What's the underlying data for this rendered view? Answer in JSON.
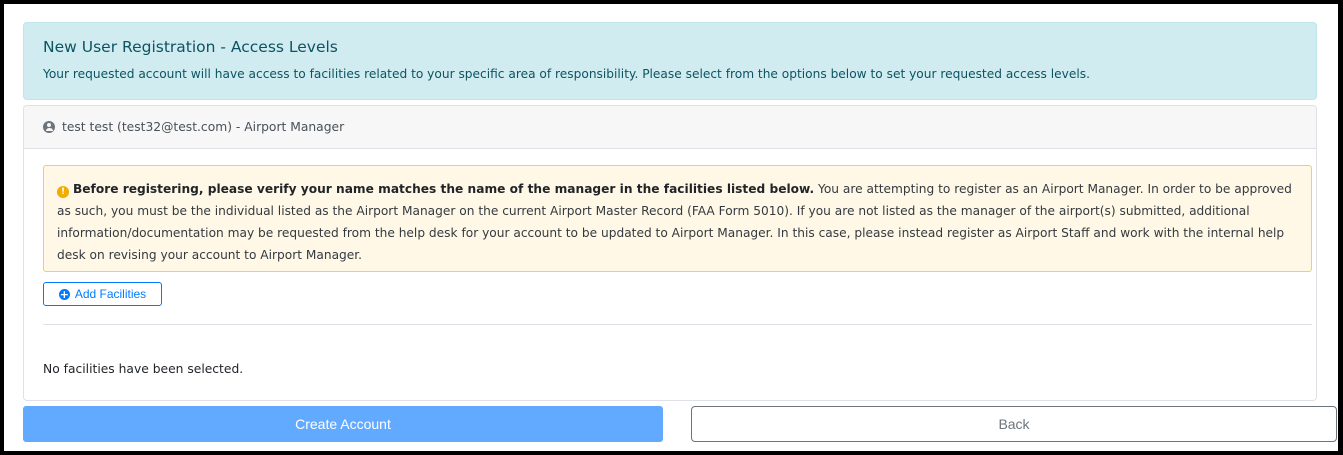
{
  "banner": {
    "title": "New User Registration - Access Levels",
    "text": "Your requested account will have access to facilities related to your specific area of responsibility. Please select from the options below to set your requested access levels."
  },
  "user_card": {
    "icon": "user-circle-icon",
    "header": "test test (test32@test.com) - Airport Manager"
  },
  "warning": {
    "icon": "exclamation-circle-icon",
    "bold": "Before registering, please verify your name matches the name of the manager in the facilities listed below.",
    "text": " You are attempting to register as an Airport Manager. In order to be approved as such, you must be the individual listed as the Airport Manager on the current Airport Master Record (FAA Form 5010). If you are not listed as the manager of the airport(s) submitted, additional information/documentation may be requested from the help desk for your account to be updated to Airport Manager. In this case, please instead register as Airport Staff and work with the internal help desk on revising your account to Airport Manager."
  },
  "facilities": {
    "add_label": "Add Facilities",
    "add_icon": "plus-circle-icon",
    "empty_message": "No facilities have been selected."
  },
  "actions": {
    "create_label": "Create Account",
    "back_label": "Back"
  },
  "colors": {
    "info_bg": "#d1ecf1",
    "info_text": "#0c5460",
    "warning_border": "#f7cd5b",
    "primary": "#007bff",
    "primary_disabled": "#62aaff"
  }
}
